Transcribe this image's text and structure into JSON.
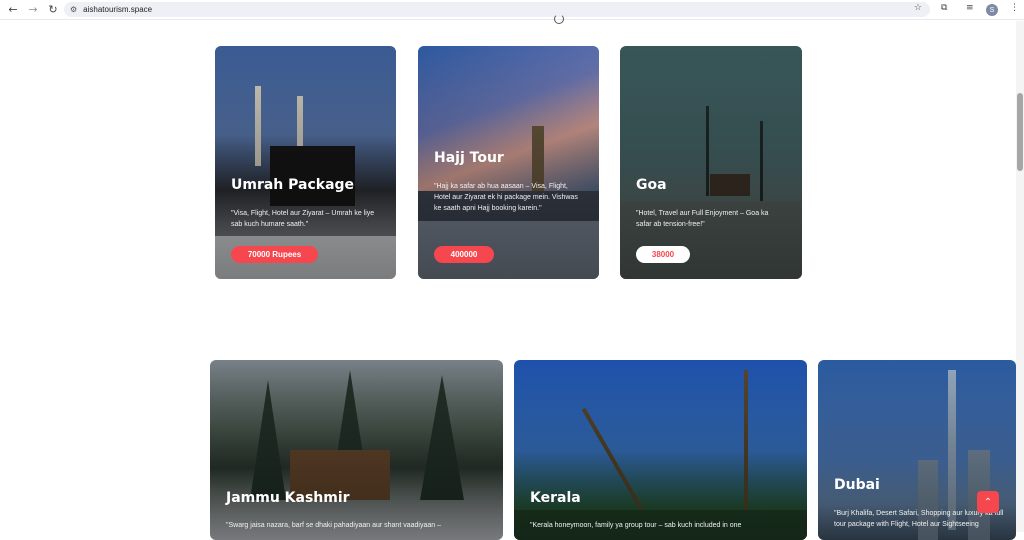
{
  "browser": {
    "url": "aishatourism.space",
    "avatar_letter": "S"
  },
  "packages_top": [
    {
      "title": "Umrah Package",
      "description": "\"Visa, Flight, Hotel aur Ziyarat – Umrah ke liye sab kuch humare saath.\"",
      "price": "70000 Rupees"
    },
    {
      "title": "Hajj Tour",
      "description": "\"Hajj ka safar ab hua aasaan – Visa, Flight, Hotel aur Ziyarat ek hi package mein. Vishwas ke saath apni Hajj booking karein.\"",
      "price": "400000"
    },
    {
      "title": "Goa",
      "description": "\"Hotel, Travel aur Full Enjoyment – Goa ka safar ab tension-free!\"",
      "price": "38000"
    }
  ],
  "packages_bottom": [
    {
      "title": "Jammu Kashmir",
      "description": "\"Swarg jaisa nazara, barf se dhaki pahadiyaan aur shant vaadiyaan –"
    },
    {
      "title": "Kerala",
      "description": "\"Kerala honeymoon, family ya group tour – sab kuch included in one"
    },
    {
      "title": "Dubai",
      "description": "\"Burj Khalifa, Desert Safari, Shopping aur luxury ka full tour package with Flight, Hotel aur Sightseeing"
    }
  ],
  "icons": {
    "back": "arrow-left-icon",
    "forward": "arrow-right-icon",
    "reload": "reload-icon",
    "bookmark": "star-icon",
    "scroll_top": "chevron-up-icon"
  },
  "colors": {
    "accent": "#f5474d"
  }
}
